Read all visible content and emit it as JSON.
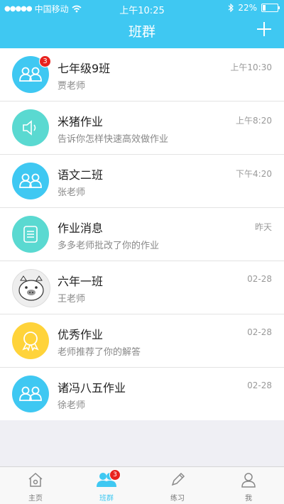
{
  "status_bar": {
    "carrier": "中国移动",
    "time": "上午10:25",
    "battery": "22%",
    "battery_level": 0.22
  },
  "header": {
    "title": "班群"
  },
  "conversations": [
    {
      "name": "七年级9班",
      "subtitle": "贾老师",
      "time": "上午10:30",
      "badge": "3",
      "icon": "group-icon",
      "color": "#3fc8f2"
    },
    {
      "name": "米猪作业",
      "subtitle": "告诉你怎样快速高效做作业",
      "time": "上午8:20",
      "icon": "speaker-icon",
      "color": "#5ad9d1"
    },
    {
      "name": "语文二班",
      "subtitle": "张老师",
      "time": "下午4:20",
      "icon": "group-icon",
      "color": "#3fc8f2"
    },
    {
      "name": "作业消息",
      "subtitle": "多多老师批改了你的作业",
      "time": "昨天",
      "icon": "document-icon",
      "color": "#5ad9d1"
    },
    {
      "name": "六年一班",
      "subtitle": "王老师",
      "time": "02-28",
      "icon": "pig-avatar",
      "color": "#eeeeee"
    },
    {
      "name": "优秀作业",
      "subtitle": "老师推荐了你的解答",
      "time": "02-28",
      "icon": "medal-icon",
      "color": "#ffd33a"
    },
    {
      "name": "诸冯八五作业",
      "subtitle": "徐老师",
      "time": "02-28",
      "icon": "group-icon",
      "color": "#3fc8f2"
    }
  ],
  "tabbar": {
    "tabs": [
      {
        "label": "主页",
        "icon": "home-icon"
      },
      {
        "label": "班群",
        "icon": "group-icon",
        "badge": "3",
        "active": true
      },
      {
        "label": "练习",
        "icon": "pencil-icon"
      },
      {
        "label": "我",
        "icon": "person-icon"
      }
    ]
  }
}
